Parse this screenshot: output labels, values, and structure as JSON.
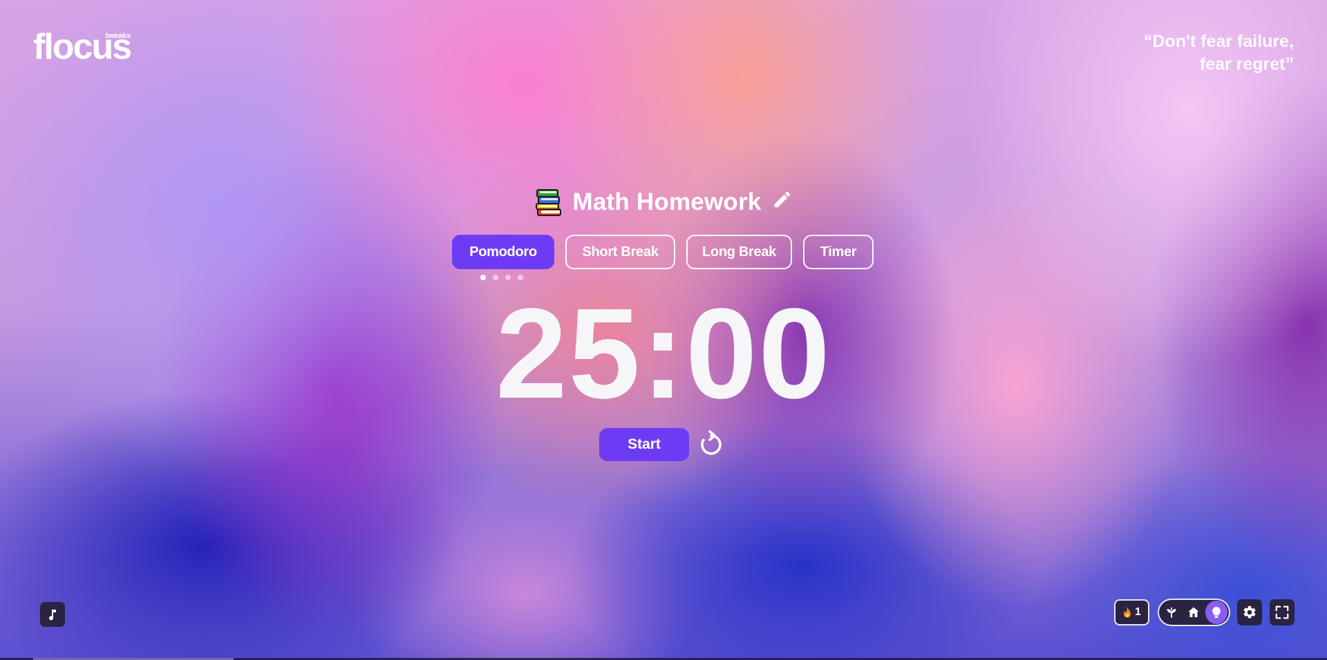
{
  "logo": {
    "main": "flocus",
    "sub": "tweaks"
  },
  "quote": {
    "line1": "“Don't fear failure,",
    "line2": "fear regret”"
  },
  "task": {
    "icon": "books-icon",
    "title": "Math Homework",
    "edit_icon": "pencil-icon"
  },
  "modes": [
    {
      "label": "Pomodoro",
      "active": true
    },
    {
      "label": "Short Break",
      "active": false
    },
    {
      "label": "Long Break",
      "active": false
    },
    {
      "label": "Timer",
      "active": false
    }
  ],
  "session_dots": {
    "total": 4,
    "current": 1
  },
  "timer": {
    "display": "25:00"
  },
  "controls": {
    "start_label": "Start",
    "reset_icon": "reset-icon"
  },
  "bottom_left": {
    "music_icon": "music-note-icon"
  },
  "bottom_right": {
    "streak": {
      "icon": "fire-icon",
      "count": "1"
    },
    "view_switch": [
      {
        "icon": "plant-icon",
        "active": false
      },
      {
        "icon": "home-icon",
        "active": false
      },
      {
        "icon": "lightbulb-icon",
        "active": true
      }
    ],
    "settings_icon": "gear-icon",
    "fullscreen_icon": "fullscreen-icon"
  },
  "colors": {
    "accent": "#6e3bf5",
    "dark_button": "#2a2342",
    "active_toggle": "#8a5cf6",
    "text": "#ffffff"
  }
}
